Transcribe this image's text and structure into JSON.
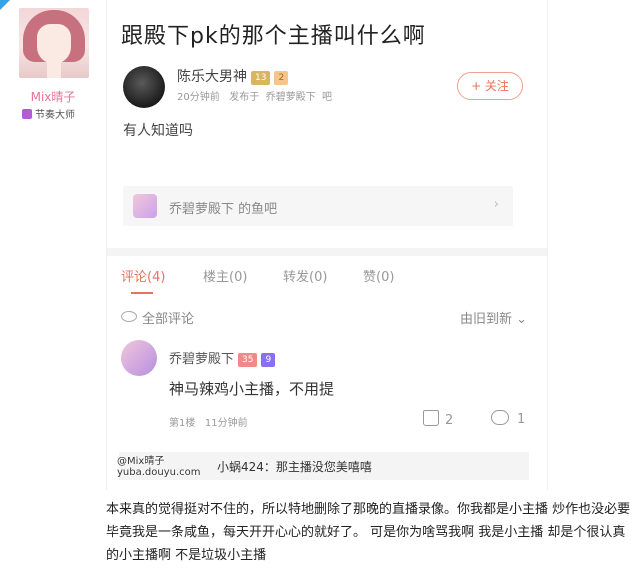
{
  "poster": {
    "name": "Mix晴子",
    "badge": "节奏大师"
  },
  "post": {
    "title": "跟殿下pk的那个主播叫什么啊",
    "author": "陈乐大男神",
    "author_level": "13",
    "time": "20分钟前",
    "posted_in_prefix": "发布于",
    "posted_in_bar": "乔碧萝殿下",
    "posted_in_suffix": "吧",
    "follow_label": "+ 关注",
    "body": "有人知道吗",
    "bar_link": "乔碧萝殿下 的鱼吧",
    "bar_arrow": "›"
  },
  "tabs": [
    {
      "label": "评论(4)",
      "active": true
    },
    {
      "label": "楼主(0)",
      "active": false
    },
    {
      "label": "转发(0)",
      "active": false
    },
    {
      "label": "赞(0)",
      "active": false
    }
  ],
  "comments_header": {
    "all_label": "全部评论",
    "sort_label": "由旧到新 ⌄"
  },
  "comment": {
    "author": "乔碧萝殿下",
    "level": "35",
    "fans_level": "9",
    "text": "神马辣鸡小主播，不用提",
    "floor": "第1楼",
    "time": "11分钟前",
    "likes": "2",
    "replies": "1",
    "sub_reply": "小蜗424：那主播没您美嘻嘻"
  },
  "watermark": {
    "line1": "@Mix晴子",
    "line2": "yuba.douyu.com"
  },
  "caption": "本来真的觉得挺对不住的，所以特地删除了那晚的直播录像。你我都是小主播 炒作也没必要 毕竟我是一条咸鱼，每天开开心心的就好了。 可是你为啥骂我啊 我是小主播 却是个很认真的小主播啊 不是垃圾小主播",
  "colors": {
    "accent": "#e8735a",
    "name_pink": "#e8739a"
  }
}
